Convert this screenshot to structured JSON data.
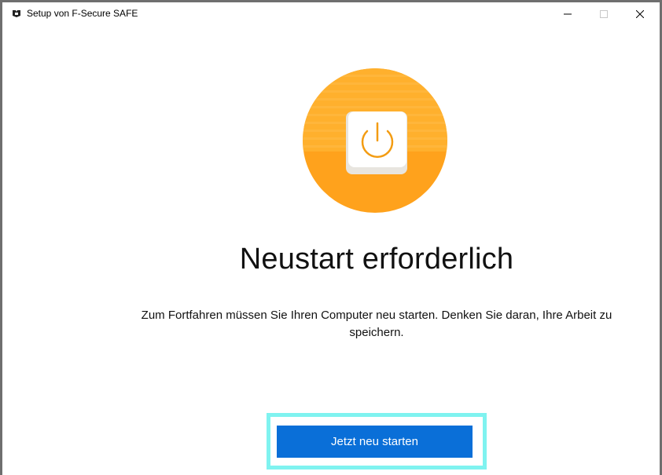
{
  "window": {
    "title": "Setup von F-Secure SAFE"
  },
  "controls": {
    "minimize_icon": "minimize-icon",
    "maximize_icon": "maximize-icon",
    "close_icon": "close-icon"
  },
  "hero": {
    "icon": "power-icon",
    "circle_color": "#ffa21c",
    "icon_color": "#f39c12"
  },
  "main": {
    "heading": "Neustart erforderlich",
    "message": "Zum Fortfahren müssen Sie Ihren Computer neu starten. Denken Sie daran, Ihre Arbeit zu speichern."
  },
  "actions": {
    "restart_label": "Jetzt neu starten",
    "button_color": "#0a6fd8",
    "focus_color": "#7ff3f0"
  }
}
